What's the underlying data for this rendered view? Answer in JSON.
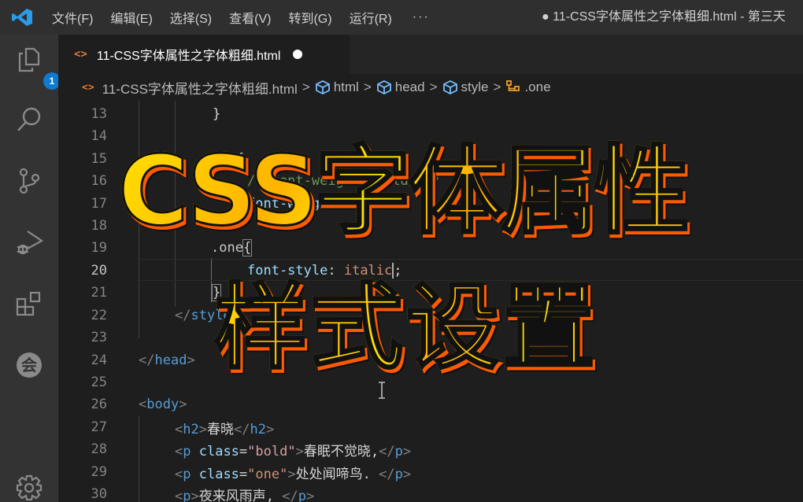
{
  "titlebar": {
    "app_icon": "vscode-logo-icon",
    "menu": [
      "文件(F)",
      "编辑(E)",
      "选择(S)",
      "查看(V)",
      "转到(G)",
      "运行(R)"
    ],
    "more": "···",
    "window_title": "● 11-CSS字体属性之字体粗细.html - 第三天"
  },
  "activitybar": {
    "items": [
      {
        "icon": "explorer-icon",
        "badge": "1"
      },
      {
        "icon": "search-icon"
      },
      {
        "icon": "source-control-icon"
      },
      {
        "icon": "run-debug-icon"
      },
      {
        "icon": "extensions-icon"
      },
      {
        "icon": "live-share-icon",
        "glyph": "会"
      },
      {
        "icon": "settings-gear-icon"
      }
    ]
  },
  "tab": {
    "icon": "<>",
    "label": "11-CSS字体属性之字体粗细.html",
    "dirty": true
  },
  "breadcrumb": {
    "file_icon": "<>",
    "items": [
      "11-CSS字体属性之字体粗细.html",
      "html",
      "head",
      "style",
      ".one"
    ],
    "separator": ">"
  },
  "editor": {
    "active_line": 20,
    "lines": [
      {
        "n": "13",
        "text": "}"
      },
      {
        "n": "14",
        "text": ""
      },
      {
        "n": "15",
        "text": "{"
      },
      {
        "n": "16",
        "text": "/* font-weight: bold; */"
      },
      {
        "n": "17",
        "text": "font-weight: 700;"
      },
      {
        "n": "18",
        "text": ""
      },
      {
        "n": "19",
        "sel": ".one",
        "brace": "{"
      },
      {
        "n": "20",
        "prop": "font-style",
        "colon": ": ",
        "val": "italic",
        "semi": ";"
      },
      {
        "n": "21",
        "text": "}"
      },
      {
        "n": "22",
        "open": "</",
        "tag": "style",
        "close": ">"
      },
      {
        "n": "23",
        "text": ""
      },
      {
        "n": "24",
        "open": "</",
        "tag": "head",
        "close": ">"
      },
      {
        "n": "25",
        "text": ""
      },
      {
        "n": "26",
        "open": "<",
        "tag": "body",
        "close": ">"
      },
      {
        "n": "27",
        "open": "<",
        "tag": "h2",
        "close": ">",
        "content": "春晓",
        "end_open": "</",
        "end_tag": "h2",
        "end_close": ">"
      },
      {
        "n": "28",
        "open": "<",
        "tag": "p",
        "attr": " class",
        "eq": "=",
        "str": "\"bold\"",
        "close": ">",
        "content": "春眠不觉晓,",
        "end_open": "</",
        "end_tag": "p",
        "end_close": ">"
      },
      {
        "n": "29",
        "open": "<",
        "tag": "p",
        "attr": " class",
        "eq": "=",
        "str": "\"one\"",
        "close": ">",
        "content": "处处闻啼鸟. ",
        "end_open": "</",
        "end_tag": "p",
        "end_close": ">"
      },
      {
        "n": "30",
        "open": "<",
        "tag": "p",
        "close": ">",
        "content": "夜来风雨声, ",
        "end_open": "</",
        "end_tag": "p",
        "end_close": ">"
      }
    ]
  },
  "overlay": {
    "line1": "CSS字体属性",
    "line2": "样式设置"
  },
  "colors": {
    "accent_blue": "#0e7ad0",
    "overlay_yellow": "#ffd000",
    "overlay_orange": "#ff5a00",
    "html_icon_orange": "#e37933"
  }
}
